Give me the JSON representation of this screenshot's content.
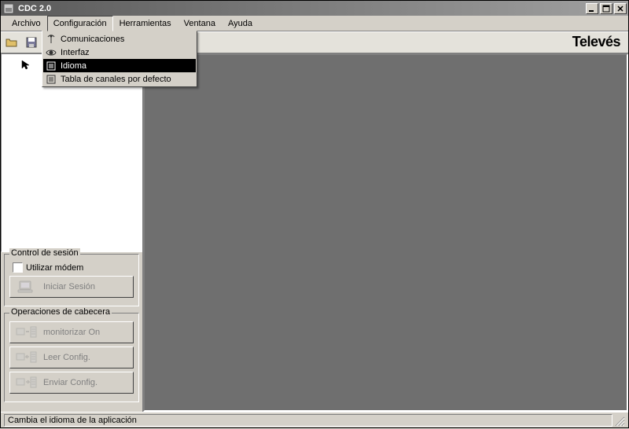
{
  "title": "CDC 2.0",
  "brand": "Televés",
  "menubar": {
    "archivo": "Archivo",
    "configuracion": "Configuración",
    "herramientas": "Herramientas",
    "ventana": "Ventana",
    "ayuda": "Ayuda"
  },
  "dropdown": {
    "comunicaciones": "Comunicaciones",
    "interfaz": "Interfaz",
    "idioma": "Idioma",
    "tabla": "Tabla de canales por defecto"
  },
  "session_panel": {
    "legend": "Control de sesión",
    "utilizar_modem": "Utilizar módem",
    "iniciar": "Iniciar Sesión"
  },
  "headend_panel": {
    "legend": "Operaciones de cabecera",
    "monitorizar": "monitorizar On",
    "leer": "Leer Config.",
    "enviar": "Enviar Config."
  },
  "status": "Cambia el idioma de la aplicación"
}
